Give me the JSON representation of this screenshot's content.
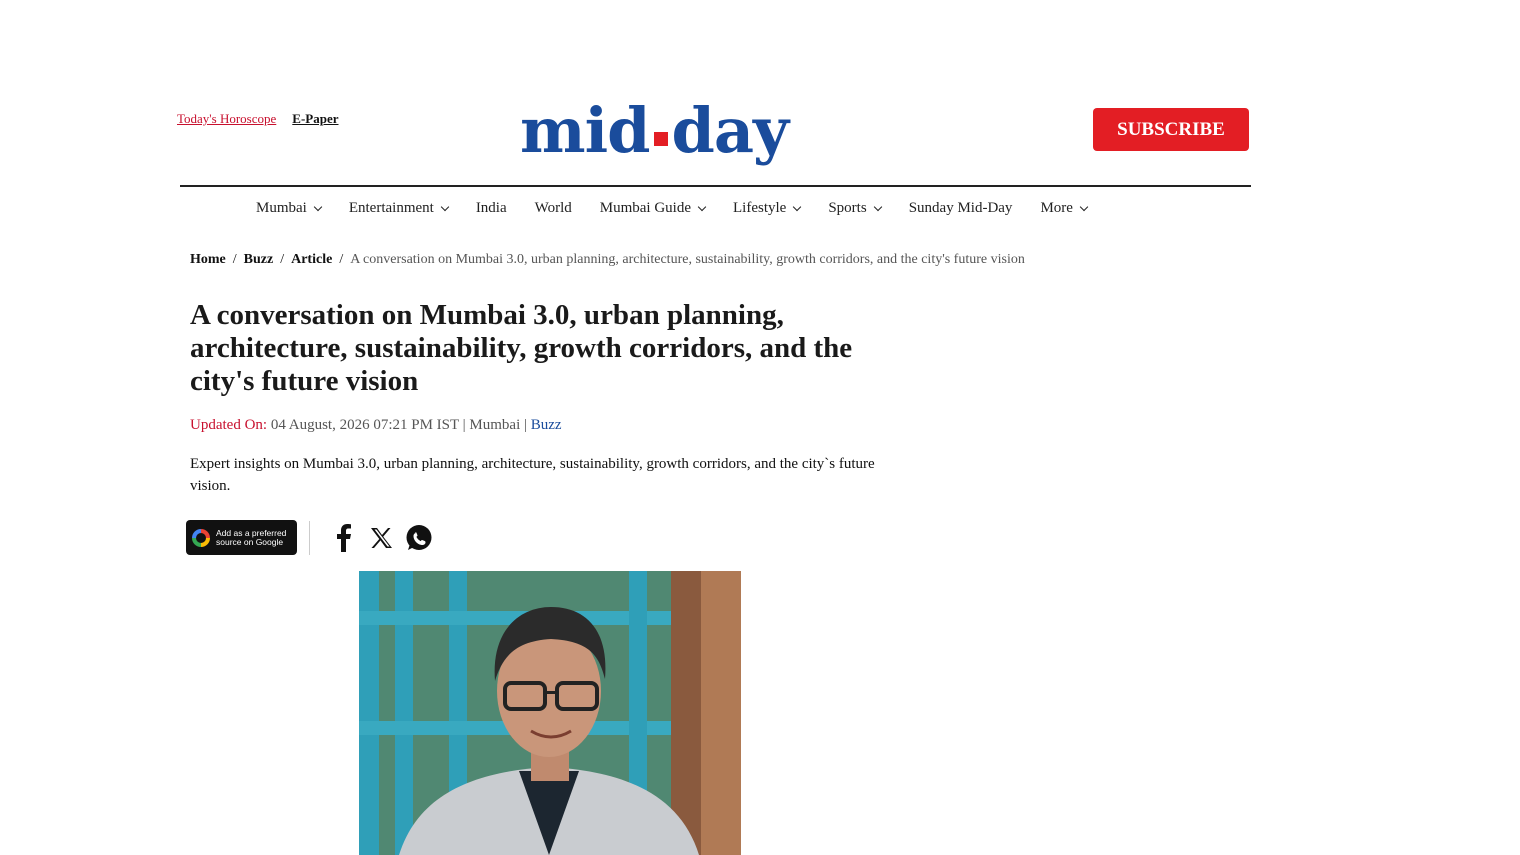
{
  "header": {
    "horoscope_link": "Today's Horoscope",
    "epaper_link": "E-Paper",
    "logo_left": "mid",
    "logo_right": "day",
    "subscribe_label": "SUBSCRIBE"
  },
  "nav": {
    "items": [
      {
        "label": "Mumbai",
        "dropdown": true
      },
      {
        "label": "Entertainment",
        "dropdown": true
      },
      {
        "label": "India",
        "dropdown": false
      },
      {
        "label": "World",
        "dropdown": false
      },
      {
        "label": "Mumbai Guide",
        "dropdown": true
      },
      {
        "label": "Lifestyle",
        "dropdown": true
      },
      {
        "label": "Sports",
        "dropdown": true
      },
      {
        "label": "Sunday Mid-Day",
        "dropdown": false
      },
      {
        "label": "More",
        "dropdown": true
      }
    ]
  },
  "breadcrumb": {
    "home": "Home",
    "section": "Buzz",
    "type": "Article",
    "current": "A conversation on Mumbai 3.0, urban planning, architecture, sustainability, growth corridors, and the city's future vision",
    "separator": "/"
  },
  "article": {
    "headline": "A conversation on Mumbai 3.0, urban planning, architecture, sustainability, growth corridors, and the city's future vision",
    "updated_label": "Updated On:",
    "updated_value": "04 August, 2026 07:21 PM IST | Mumbai |",
    "category": "Buzz",
    "summary": "Expert insights on Mumbai 3.0, urban planning, architecture, sustainability, growth corridors, and the city`s future vision."
  },
  "share": {
    "google_badge_line1": "Add as a preferred",
    "google_badge_line2": "source on Google",
    "icons": [
      "facebook-icon",
      "x-icon",
      "whatsapp-icon"
    ]
  },
  "colors": {
    "brand_blue": "#1a4c9c",
    "brand_red": "#e31e24",
    "accent_red": "#c8102e"
  }
}
